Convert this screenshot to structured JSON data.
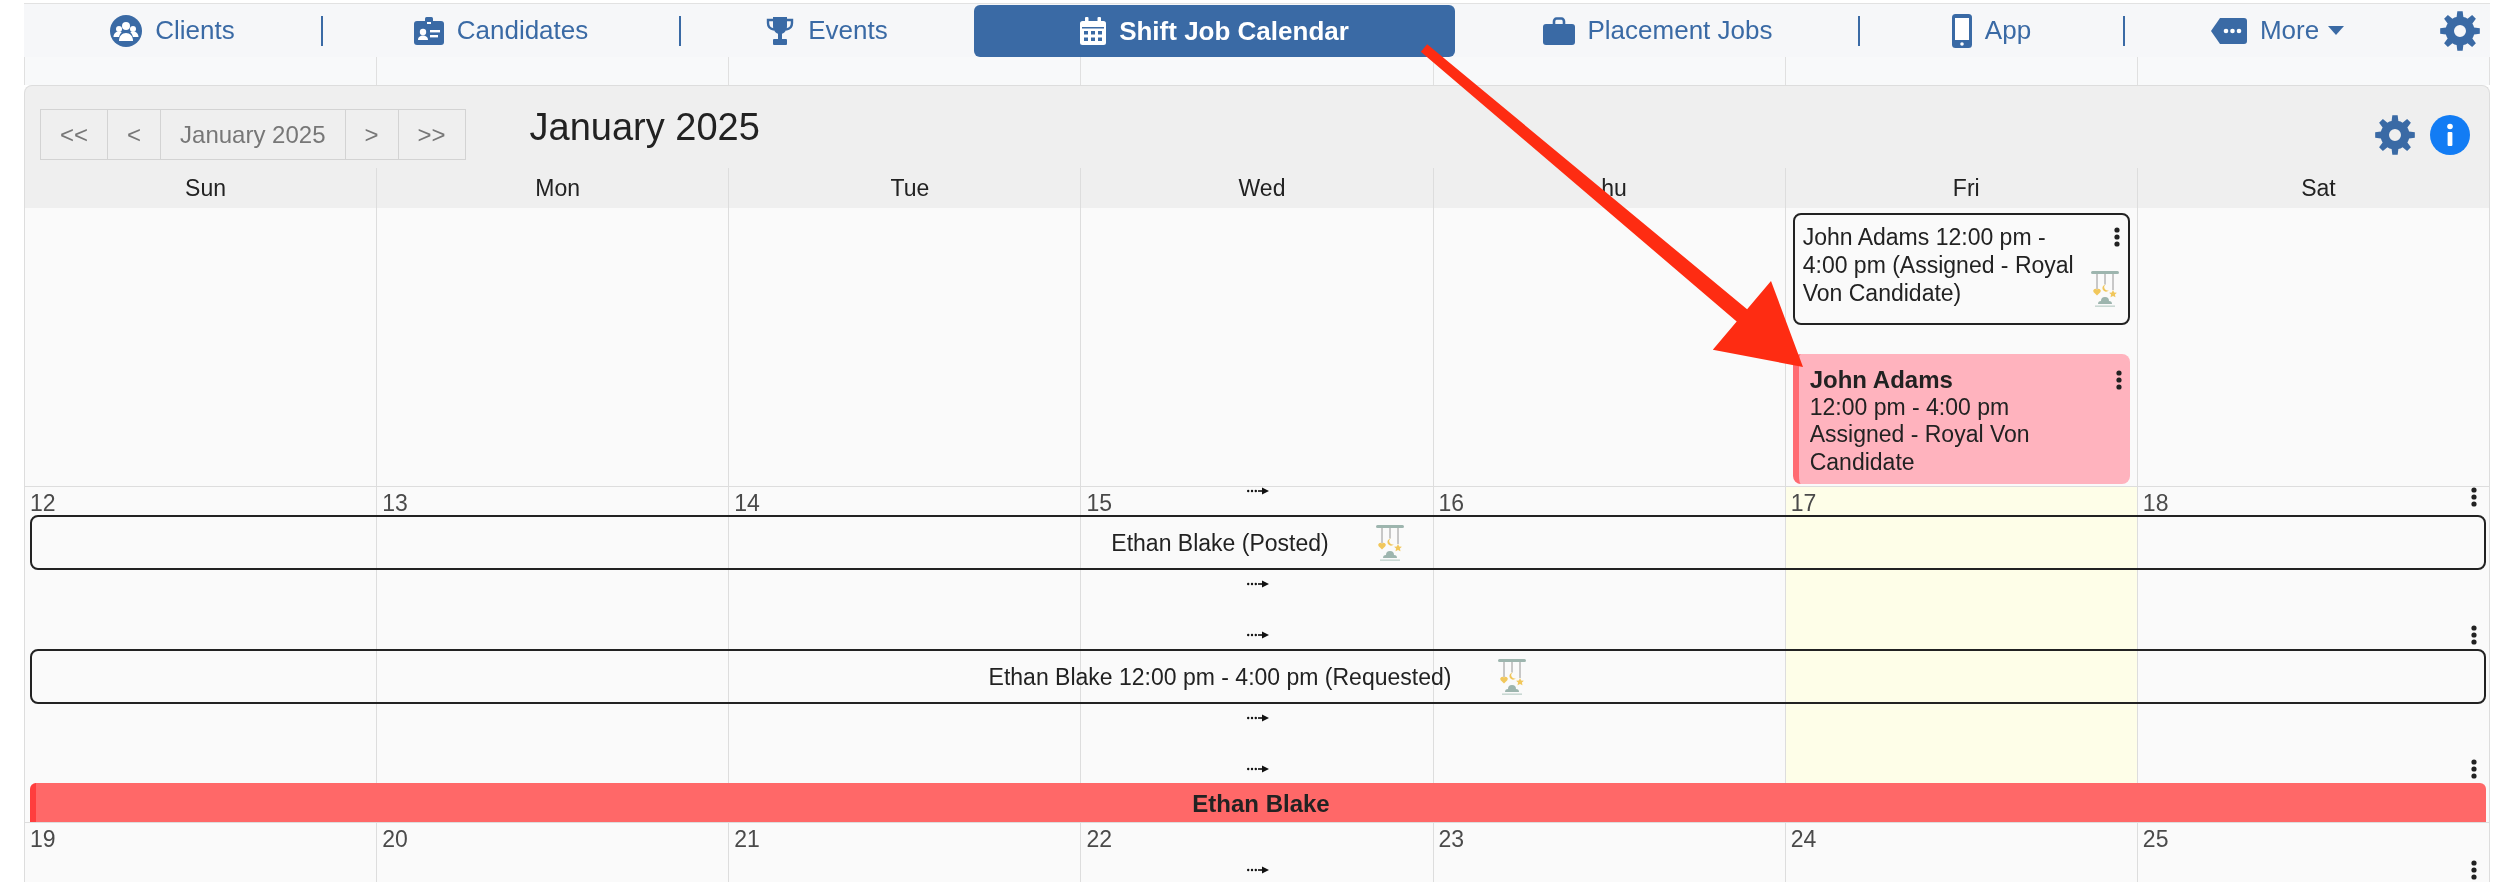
{
  "nav": {
    "items": [
      {
        "label": "Clients",
        "kind": "link",
        "selected": false
      },
      {
        "label": "Candidates",
        "kind": "link",
        "selected": false
      },
      {
        "label": "Events",
        "kind": "link",
        "selected": false
      },
      {
        "label": "Shift Job Calendar",
        "kind": "link",
        "selected": true
      },
      {
        "label": "Placement Jobs",
        "kind": "link",
        "selected": false
      },
      {
        "label": "App",
        "kind": "link",
        "selected": false
      },
      {
        "label": "More",
        "kind": "menu",
        "selected": false
      }
    ]
  },
  "toolbar": {
    "buttons": [
      "<<",
      "<",
      "January 2025",
      ">",
      ">>"
    ],
    "title": "January 2025"
  },
  "calendar": {
    "weekdays": [
      "Sun",
      "Mon",
      "Tue",
      "Wed",
      "hu",
      "Fri",
      "Sat"
    ],
    "weeks": [
      {
        "days": [
          {
            "today": false
          },
          {
            "today": false
          },
          {
            "today": false
          },
          {
            "today": false
          },
          {
            "today": false
          },
          {
            "today": false,
            "events": [
              {
                "kind": "outline",
                "text": "John Adams 12:00 pm - 4:00 pm (Assigned - Royal Von Candidate)"
              },
              {
                "kind": "filled",
                "color": "#ffb3be",
                "title": "John Adams",
                "time": "12:00 pm - 4:00 pm",
                "status": "Assigned - Royal Von Candidate"
              }
            ]
          },
          {
            "today": false
          }
        ]
      },
      {
        "days": [
          {
            "date": "12",
            "today": false
          },
          {
            "date": "13",
            "today": false
          },
          {
            "date": "14",
            "today": false
          },
          {
            "date": "15",
            "today": false
          },
          {
            "date": "16",
            "today": false
          },
          {
            "date": "17",
            "today": true
          },
          {
            "date": "18",
            "today": false
          }
        ],
        "events": [
          {
            "kind": "outline",
            "text": "Ethan Blake (Posted)"
          },
          {
            "kind": "outline",
            "text": "Ethan Blake 12:00 pm - 4:00 pm (Requested)"
          },
          {
            "kind": "filled",
            "color": "#ff6868",
            "title": "Ethan Blake"
          }
        ]
      },
      {
        "days": [
          {
            "date": "19",
            "today": false
          },
          {
            "date": "20",
            "today": false
          },
          {
            "date": "21",
            "today": false
          },
          {
            "date": "22",
            "today": false
          },
          {
            "date": "23",
            "today": false
          },
          {
            "date": "24",
            "today": false
          },
          {
            "date": "25",
            "today": false
          }
        ]
      }
    ]
  }
}
